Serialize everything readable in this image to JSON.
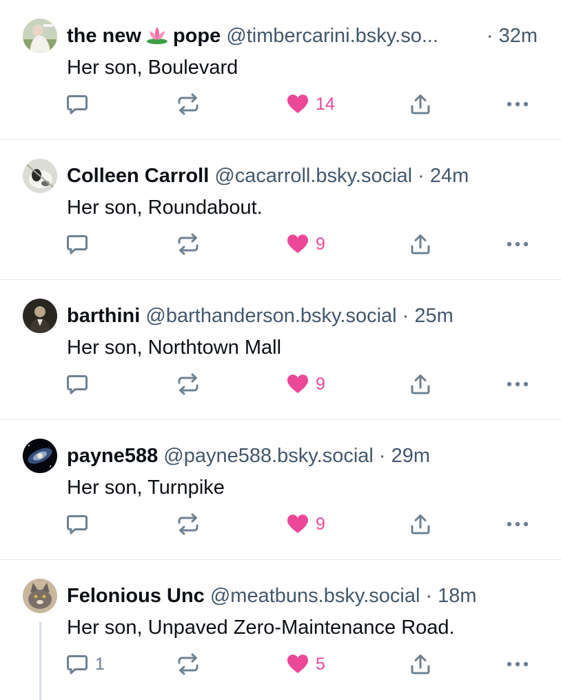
{
  "colors": {
    "like": "#ec4899",
    "icon": "#6e8091",
    "meta_text": "#42576c",
    "divider": "#e3e7eb"
  },
  "icons": {
    "reply": "speech-bubble-icon",
    "repost": "repost-arrows-icon",
    "like": "heart-icon",
    "share": "share-upload-icon",
    "more": "ellipsis-icon"
  },
  "posts": [
    {
      "display_name_start": "the new",
      "display_name_emoji": "lotus-emoji",
      "display_name_end": "pope",
      "handle": "@timbercarini.bsky.so...",
      "time": "· 32m",
      "text": "Her son, Boulevard",
      "reply_count": "",
      "like_count": "14",
      "liked": true
    },
    {
      "display_name": "Colleen Carroll",
      "handle": "@cacarroll.bsky.social",
      "time": "· 24m",
      "text": "Her son, Roundabout.",
      "reply_count": "",
      "like_count": "9",
      "liked": true
    },
    {
      "display_name": "barthini",
      "handle": "@barthanderson.bsky.social",
      "time": "· 25m",
      "text": "Her son, Northtown Mall",
      "reply_count": "",
      "like_count": "9",
      "liked": true
    },
    {
      "display_name": "payne588",
      "handle": "@payne588.bsky.social",
      "time": "· 29m",
      "text": "Her son, Turnpike",
      "reply_count": "",
      "like_count": "9",
      "liked": true
    },
    {
      "display_name": "Felonious Unc",
      "handle": "@meatbuns.bsky.social",
      "time": "· 18m",
      "text": "Her son, Unpaved Zero-Maintenance Road.",
      "reply_count": "1",
      "like_count": "5",
      "liked": true
    }
  ]
}
